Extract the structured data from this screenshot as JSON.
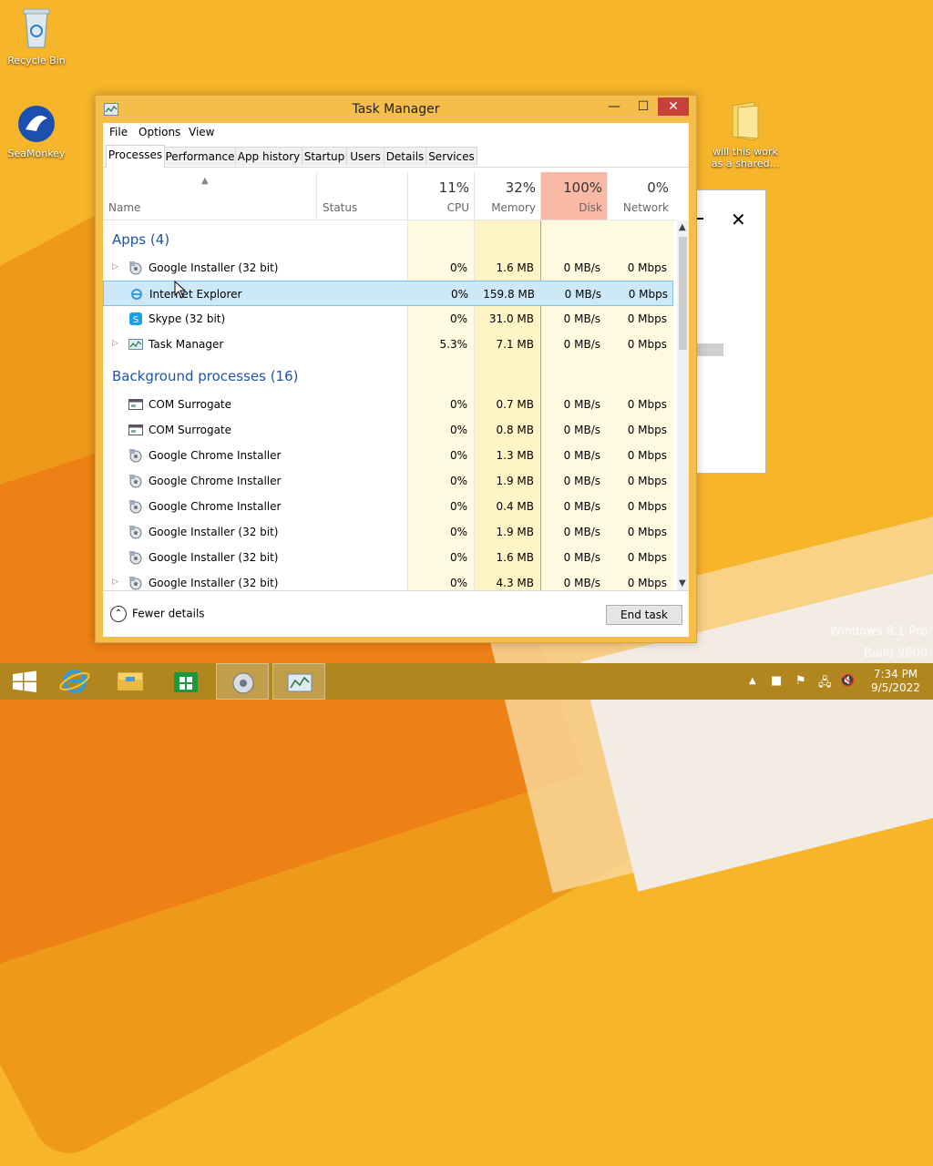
{
  "desktop": {
    "icons": [
      {
        "label": "Recycle Bin"
      },
      {
        "label": "SeaMonkey"
      },
      {
        "label": "will this work as a shared..."
      }
    ],
    "watermark": [
      "Windows 8.1 Pro",
      "Build 9600"
    ]
  },
  "window": {
    "title": "Task Manager",
    "controls": {
      "minimize": "—",
      "maximize": "☐",
      "close": "✕"
    }
  },
  "menu": [
    "File",
    "Options",
    "View"
  ],
  "tabs": [
    "Processes",
    "Performance",
    "App history",
    "Startup",
    "Users",
    "Details",
    "Services"
  ],
  "columns": {
    "name": "Name",
    "status": "Status",
    "cpu": {
      "pct": "11%",
      "label": "CPU"
    },
    "memory": {
      "pct": "32%",
      "label": "Memory"
    },
    "disk": {
      "pct": "100%",
      "label": "Disk"
    },
    "network": {
      "pct": "0%",
      "label": "Network"
    }
  },
  "sections": {
    "apps": "Apps (4)",
    "background": "Background processes (16)"
  },
  "apps": [
    {
      "name": "Google Installer (32 bit)",
      "cpu": "0%",
      "mem": "1.6 MB",
      "disk": "0 MB/s",
      "net": "0 Mbps",
      "expand": true,
      "icon": "installer-icon"
    },
    {
      "name": "Internet Explorer",
      "cpu": "0%",
      "mem": "159.8 MB",
      "disk": "0 MB/s",
      "net": "0 Mbps",
      "expand": false,
      "icon": "ie-icon"
    },
    {
      "name": "Skype (32 bit)",
      "cpu": "0%",
      "mem": "31.0 MB",
      "disk": "0 MB/s",
      "net": "0 Mbps",
      "expand": false,
      "icon": "skype-icon"
    },
    {
      "name": "Task Manager",
      "cpu": "5.3%",
      "mem": "7.1 MB",
      "disk": "0 MB/s",
      "net": "0 Mbps",
      "expand": true,
      "icon": "taskmgr-icon"
    }
  ],
  "background": [
    {
      "name": "COM Surrogate",
      "cpu": "0%",
      "mem": "0.7 MB",
      "disk": "0 MB/s",
      "net": "0 Mbps",
      "expand": false,
      "icon": "window-icon"
    },
    {
      "name": "COM Surrogate",
      "cpu": "0%",
      "mem": "0.8 MB",
      "disk": "0 MB/s",
      "net": "0 Mbps",
      "expand": false,
      "icon": "window-icon"
    },
    {
      "name": "Google Chrome Installer",
      "cpu": "0%",
      "mem": "1.3 MB",
      "disk": "0 MB/s",
      "net": "0 Mbps",
      "expand": false,
      "icon": "installer-icon"
    },
    {
      "name": "Google Chrome Installer",
      "cpu": "0%",
      "mem": "1.9 MB",
      "disk": "0 MB/s",
      "net": "0 Mbps",
      "expand": false,
      "icon": "installer-icon"
    },
    {
      "name": "Google Chrome Installer",
      "cpu": "0%",
      "mem": "0.4 MB",
      "disk": "0 MB/s",
      "net": "0 Mbps",
      "expand": false,
      "icon": "installer-icon"
    },
    {
      "name": "Google Installer (32 bit)",
      "cpu": "0%",
      "mem": "1.9 MB",
      "disk": "0 MB/s",
      "net": "0 Mbps",
      "expand": false,
      "icon": "installer-icon"
    },
    {
      "name": "Google Installer (32 bit)",
      "cpu": "0%",
      "mem": "1.6 MB",
      "disk": "0 MB/s",
      "net": "0 Mbps",
      "expand": false,
      "icon": "installer-icon"
    },
    {
      "name": "Google Installer (32 bit)",
      "cpu": "0%",
      "mem": "4.3 MB",
      "disk": "0 MB/s",
      "net": "0 Mbps",
      "expand": true,
      "icon": "installer-icon"
    }
  ],
  "footer": {
    "fewer": "Fewer details",
    "end_task": "End task"
  },
  "taskbar": {
    "time": "7:34 PM",
    "date": "9/5/2022"
  },
  "colors": {
    "accent": "#f5bd4a",
    "disk_hot": "#f9b9a5",
    "section": "#1e55a3",
    "selected": "#cde8f7"
  }
}
